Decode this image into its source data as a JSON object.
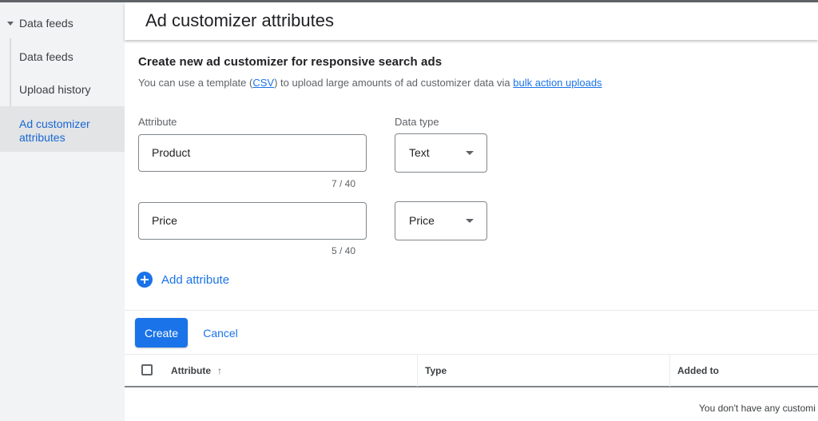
{
  "sidebar": {
    "parent_label": "Data feeds",
    "items": [
      {
        "label": "Data feeds"
      },
      {
        "label": "Upload history"
      },
      {
        "label": "Ad customizer attributes"
      }
    ]
  },
  "header": {
    "title": "Ad customizer attributes"
  },
  "form": {
    "title": "Create new ad customizer for responsive search ads",
    "desc_prefix": "You can use a template (",
    "desc_csv_link": "CSV",
    "desc_middle": ") to upload large amounts of ad customizer data via ",
    "desc_bulk_link": "bulk action uploads",
    "attribute_label": "Attribute",
    "data_type_label": "Data type",
    "rows": [
      {
        "attribute": "Product",
        "counter": "7 / 40",
        "data_type": "Text"
      },
      {
        "attribute": "Price",
        "counter": "5 / 40",
        "data_type": "Price"
      }
    ],
    "add_attribute_label": "Add attribute",
    "create_label": "Create",
    "cancel_label": "Cancel"
  },
  "table": {
    "columns": [
      "Attribute",
      "Type",
      "Added to"
    ],
    "sort_indicator": "↑",
    "empty_message": "You don't have any customi"
  },
  "colors": {
    "accent": "#1a73e8",
    "sidebar_bg": "#f1f3f4",
    "active_bg": "#e2e4e6"
  }
}
